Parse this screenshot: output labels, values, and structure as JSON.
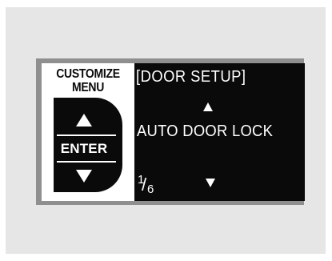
{
  "sidebar": {
    "title_line1": "CUSTOMIZE",
    "title_line2": "MENU",
    "enter_label": "ENTER",
    "up_icon": "triangle-up-icon",
    "down_icon": "triangle-down-icon"
  },
  "screen": {
    "title": "[DOOR SETUP]",
    "item": "AUTO DOOR LOCK",
    "page_current": "1",
    "page_separator": "/",
    "page_total": "6"
  },
  "colors": {
    "background": "#e6e6e7",
    "frame": "#8f8f8f",
    "display": "#0a0a0a",
    "text": "#ffffff"
  }
}
